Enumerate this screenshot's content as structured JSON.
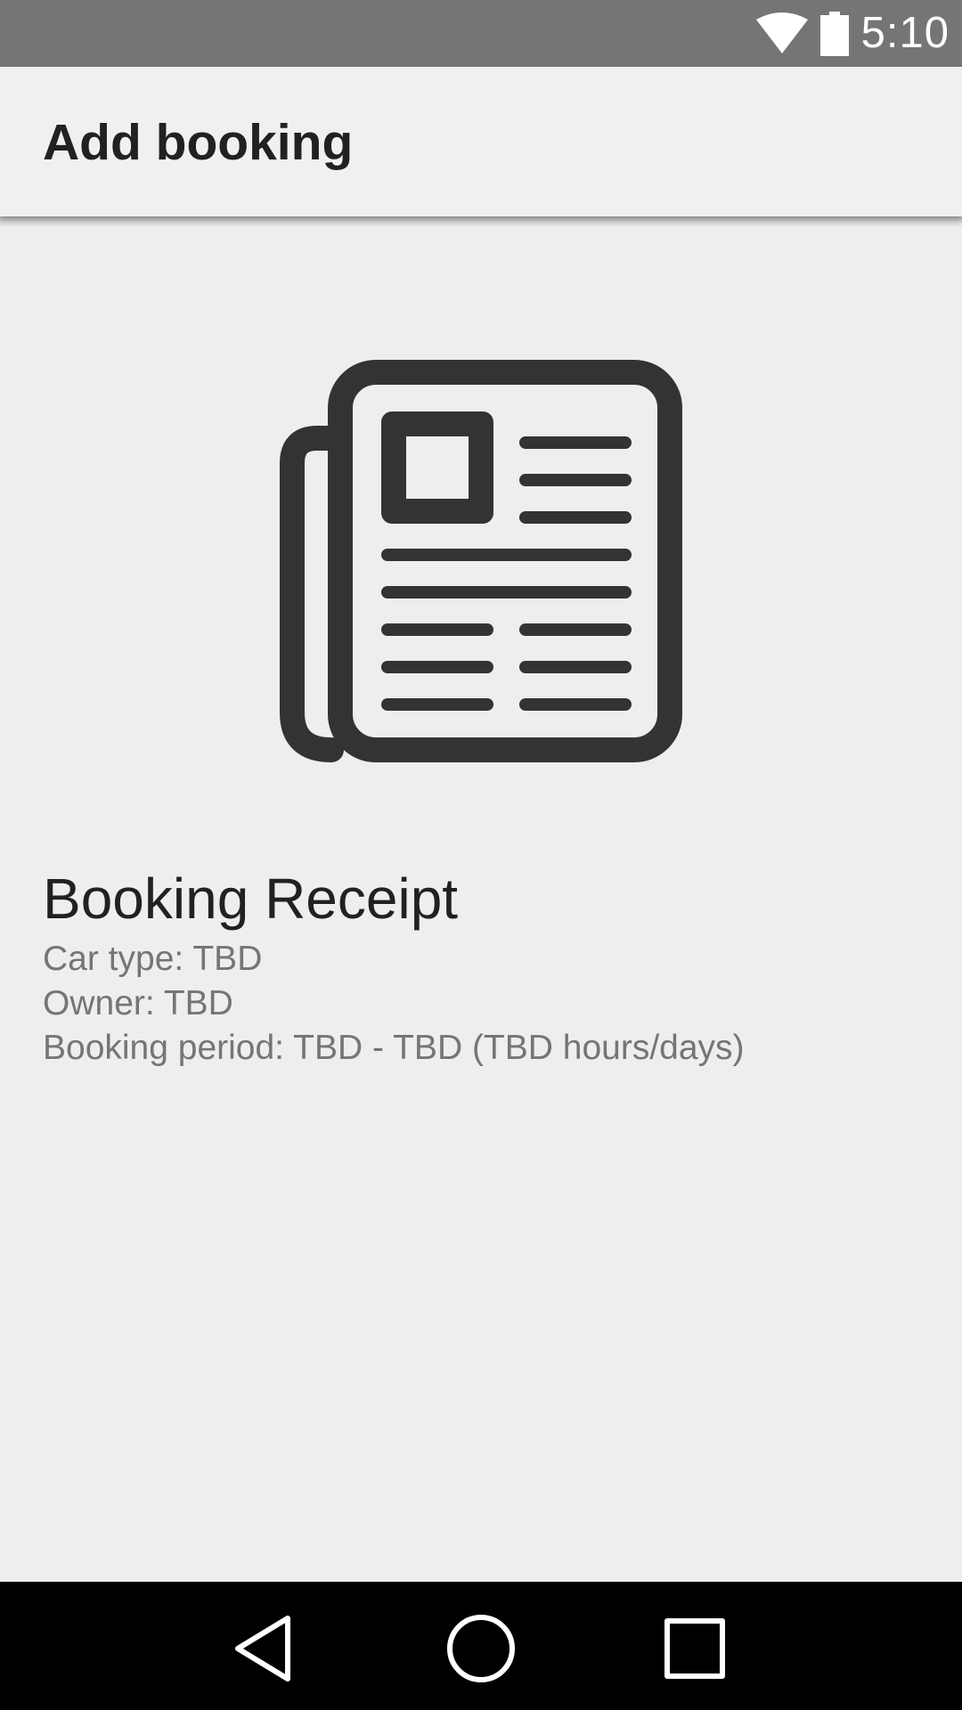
{
  "status_bar": {
    "time": "5:10",
    "icons": [
      "wifi-icon",
      "battery-icon"
    ],
    "background": "#757575"
  },
  "app_bar": {
    "title": "Add booking",
    "background": "#f0f0f0"
  },
  "content": {
    "icon": "newspaper-icon",
    "receipt": {
      "title": "Booking Receipt",
      "car_type": "Car type: TBD",
      "owner": "Owner: TBD",
      "booking_period": "Booking period: TBD - TBD (TBD hours/days)"
    }
  },
  "nav_bar": {
    "buttons": [
      "back-icon",
      "home-icon",
      "recents-icon"
    ],
    "background": "#000000"
  }
}
